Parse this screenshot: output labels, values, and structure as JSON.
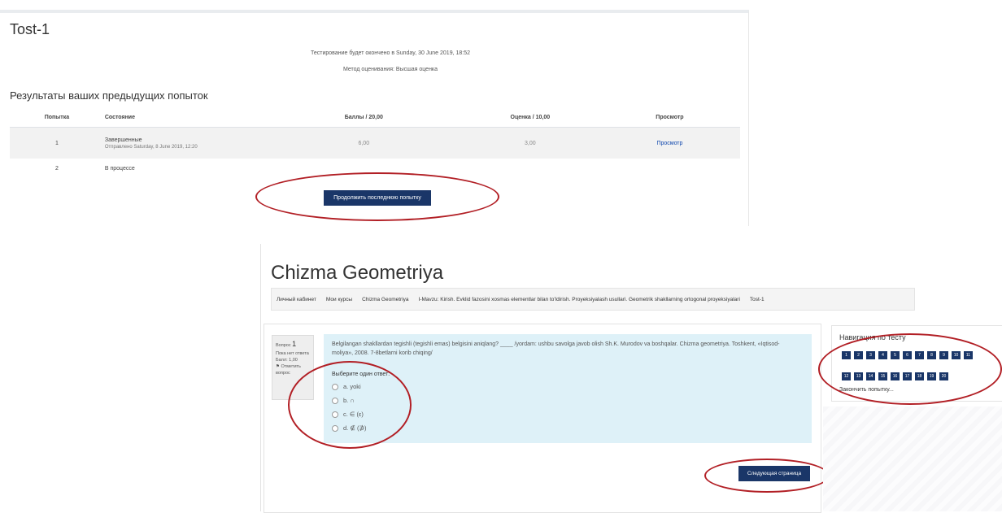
{
  "quiz": {
    "title": "Tost-1",
    "close_note": "Тестирование будет окончено в Sunday, 30 June 2019, 18:52",
    "grading_note": "Метод оценивания: Высшая оценка",
    "attempts_heading": "Результаты ваших предыдущих попыток",
    "table": {
      "headers": [
        "Попытка",
        "Состояние",
        "Баллы / 20,00",
        "Оценка / 10,00",
        "Просмотр"
      ],
      "rows": [
        {
          "attempt": "1",
          "state": "Завершенные",
          "submitted": "Отправлено Saturday, 8 June 2019, 12:20",
          "marks": "6,00",
          "grade": "3,00",
          "review": "Просмотр"
        },
        {
          "attempt": "2",
          "state": "В процессе",
          "submitted": "",
          "marks": "",
          "grade": "",
          "review": ""
        }
      ]
    },
    "continue_button": "Продолжить последнюю попытку"
  },
  "course": {
    "title": "Chizma Geometriya",
    "breadcrumb": [
      "Личный кабинет",
      "Мои курсы",
      "Chizma Geometriya",
      "I-Mavzu: Kirish. Evklid fazosini xosmas elementlar bilan to'ldirish. Proyeksiyalash usullari. Geometrik shakllarning ortogonal proyeksiyalari",
      "Tost-1"
    ]
  },
  "question": {
    "label": "Вопрос",
    "number": "1",
    "status": "Пока нет ответа",
    "mark": "Балл: 1,00",
    "flag": "Отметить вопрос",
    "text": "Belgilangan shakllardan tegishli (tegishli emas) belgisini aniqlang? ____ /yordam: ushbu savolga javob olish Sh.K. Murodov va boshqalar. Chizma geometriya. Toshkent, «Iqtisod-moliya», 2008. 7-8betlarni korib chiqing/",
    "choose_label": "Выберите один ответ:",
    "options": [
      "a. yoki",
      "b. ∩",
      "c. ∈ (ε)",
      "d. ∉ (∌)"
    ],
    "next_button": "Следующая страница"
  },
  "navigation": {
    "title": "Навигация по тесту",
    "row1": [
      "1",
      "2",
      "3",
      "4",
      "5",
      "6",
      "7",
      "8",
      "9",
      "10",
      "11"
    ],
    "row2": [
      "12",
      "13",
      "14",
      "15",
      "16",
      "17",
      "18",
      "19",
      "20"
    ],
    "finish": "Закончить попытку..."
  },
  "colors": {
    "accent": "#1a3668",
    "highlight": "#b21f25",
    "question_bg": "#def1f8"
  }
}
